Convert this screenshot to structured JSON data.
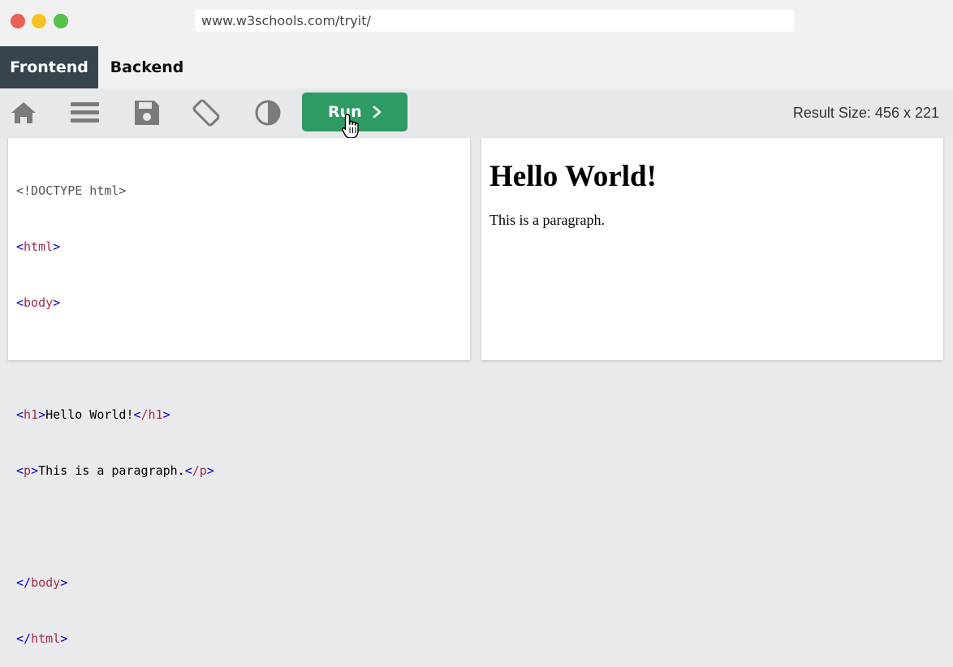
{
  "browser": {
    "url": "www.w3schools.com/tryit/"
  },
  "tabs": [
    {
      "label": "Frontend",
      "active": true
    },
    {
      "label": "Backend",
      "active": false
    }
  ],
  "toolbar": {
    "icons": [
      "home-icon",
      "menu-icon",
      "save-icon",
      "rotate-icon",
      "contrast-icon"
    ],
    "run_label": "Run",
    "result_size": "Result Size: 456 x 221"
  },
  "editor": {
    "lines": [
      {
        "kind": "doctype",
        "text": "<!DOCTYPE html>"
      },
      {
        "kind": "tag",
        "open": "<",
        "name": "html",
        "close": ">"
      },
      {
        "kind": "tag",
        "open": "<",
        "name": "body",
        "close": ">"
      },
      {
        "kind": "blank"
      },
      {
        "kind": "inline",
        "tag1": "h1",
        "text": "Hello World!",
        "tag2": "/h1"
      },
      {
        "kind": "inline",
        "tag1": "p",
        "text": "This is a paragraph.",
        "tag2": "/p"
      },
      {
        "kind": "blank"
      },
      {
        "kind": "tag",
        "open": "</",
        "name": "body",
        "close": ">"
      },
      {
        "kind": "tag",
        "open": "</",
        "name": "html",
        "close": ">"
      }
    ]
  },
  "result": {
    "heading": "Hello World!",
    "paragraph": "This is a paragraph."
  },
  "colors": {
    "run_button": "#2f9b64",
    "active_tab": "#38444d",
    "code_tag": "#a52a4a",
    "code_bracket": "#0000cd"
  }
}
